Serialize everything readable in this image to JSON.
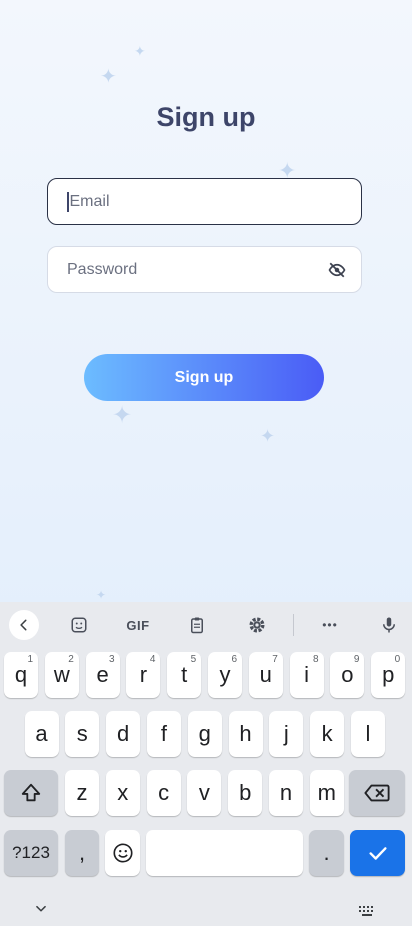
{
  "page": {
    "title": "Sign up"
  },
  "form": {
    "email_placeholder": "Email",
    "password_placeholder": "Password",
    "submit_label": "Sign up"
  },
  "keyboard": {
    "toolbar": {
      "gif_label": "GIF",
      "more_label": "•••"
    },
    "row1": [
      {
        "k": "q",
        "n": "1"
      },
      {
        "k": "w",
        "n": "2"
      },
      {
        "k": "e",
        "n": "3"
      },
      {
        "k": "r",
        "n": "4"
      },
      {
        "k": "t",
        "n": "5"
      },
      {
        "k": "y",
        "n": "6"
      },
      {
        "k": "u",
        "n": "7"
      },
      {
        "k": "i",
        "n": "8"
      },
      {
        "k": "o",
        "n": "9"
      },
      {
        "k": "p",
        "n": "0"
      }
    ],
    "row2": [
      "a",
      "s",
      "d",
      "f",
      "g",
      "h",
      "j",
      "k",
      "l"
    ],
    "row3": [
      "z",
      "x",
      "c",
      "v",
      "b",
      "n",
      "m"
    ],
    "symbols_label": "?123",
    "comma_label": ",",
    "period_label": "."
  },
  "colors": {
    "accent": "#1a73e8",
    "title": "#3d4569",
    "button_start": "#6cbcff",
    "button_end": "#4a5cf6"
  },
  "icons": [
    "sparkle-icon",
    "eye-off-icon",
    "chevron-left-icon",
    "sticker-icon",
    "clipboard-icon",
    "gear-icon",
    "more-icon",
    "mic-icon",
    "shift-icon",
    "backspace-icon",
    "emoji-icon",
    "check-icon",
    "chevron-down-icon",
    "keyboard-icon"
  ]
}
